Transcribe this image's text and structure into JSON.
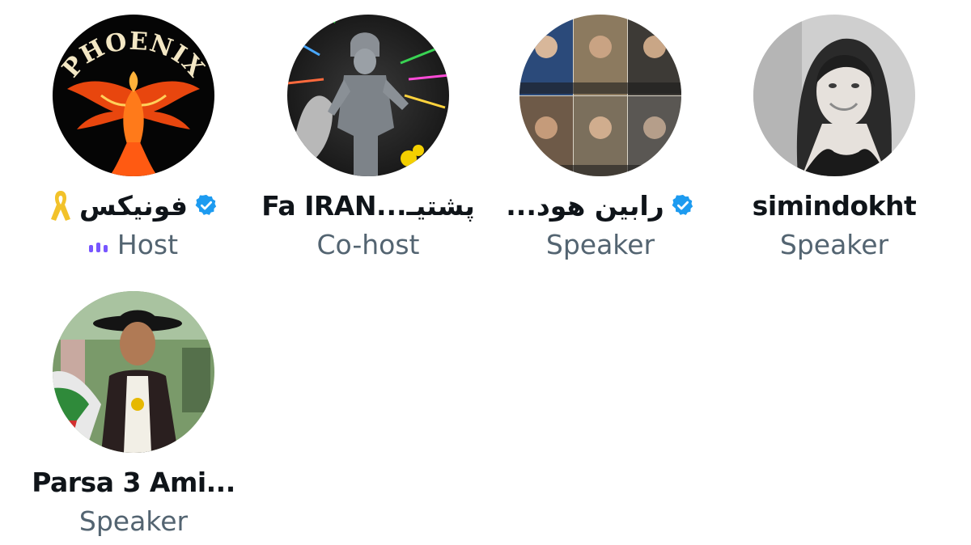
{
  "participants": [
    {
      "name": "فونیکس",
      "verified": true,
      "badge": "yellow-ribbon",
      "role": "Host",
      "speaking": true,
      "avatar": "phoenix-logo",
      "avatar_text": "PHOENIX"
    },
    {
      "name": "پشتیـ...Fa IRAN",
      "verified": false,
      "role": "Co-host",
      "avatar": "warrior-statue"
    },
    {
      "name": "رابین هود...",
      "verified": true,
      "role": "Speaker",
      "avatar": "portrait-collage"
    },
    {
      "name": "simindokht",
      "verified": false,
      "role": "Speaker",
      "avatar": "woman-portrait"
    },
    {
      "name": "Parsa 3 Ami...",
      "verified": false,
      "role": "Speaker",
      "avatar": "man-with-hat"
    }
  ],
  "colors": {
    "verified": "#1d9bf0",
    "speaking": "#7856ff",
    "role_text": "#536471",
    "name_text": "#0f1419",
    "ribbon": "#f2c22a"
  }
}
